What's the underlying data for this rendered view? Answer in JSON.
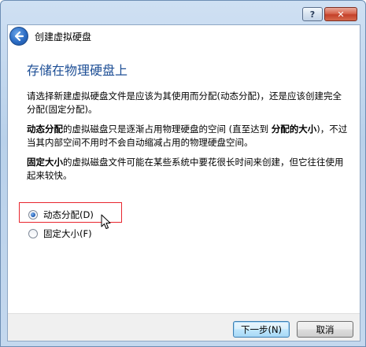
{
  "window": {
    "title": "创建虚拟硬盘",
    "help_label": "?",
    "close_label": "✕"
  },
  "page": {
    "heading": "存储在物理硬盘上",
    "intro": "请选择新建虚拟硬盘文件是应该为其使用而分配(动态分配)，还是应该创建完全分配(固定分配)。",
    "dynamic_term": "动态分配",
    "dynamic_desc_a": "的虚拟磁盘只是逐渐占用物理硬盘的空间 (直至达到 ",
    "dynamic_term2": "分配的大小",
    "dynamic_desc_b": ")，不过当其内部空间不用时不会自动缩减占用的物理硬盘空间。",
    "fixed_term": "固定大小",
    "fixed_desc": "的虚拟磁盘文件可能在某些系统中要花很长时间来创建，但它往往使用起来较快。"
  },
  "options": {
    "dynamic_label": "动态分配(D)",
    "fixed_label": "固定大小(F)",
    "selected": "dynamic"
  },
  "buttons": {
    "next": "下一步(N)",
    "cancel": "取消"
  },
  "icons": {
    "back": "back-arrow-icon",
    "cursor": "mouse-pointer-icon"
  },
  "colors": {
    "heading": "#1e4f96",
    "highlight": "#e8262e"
  }
}
